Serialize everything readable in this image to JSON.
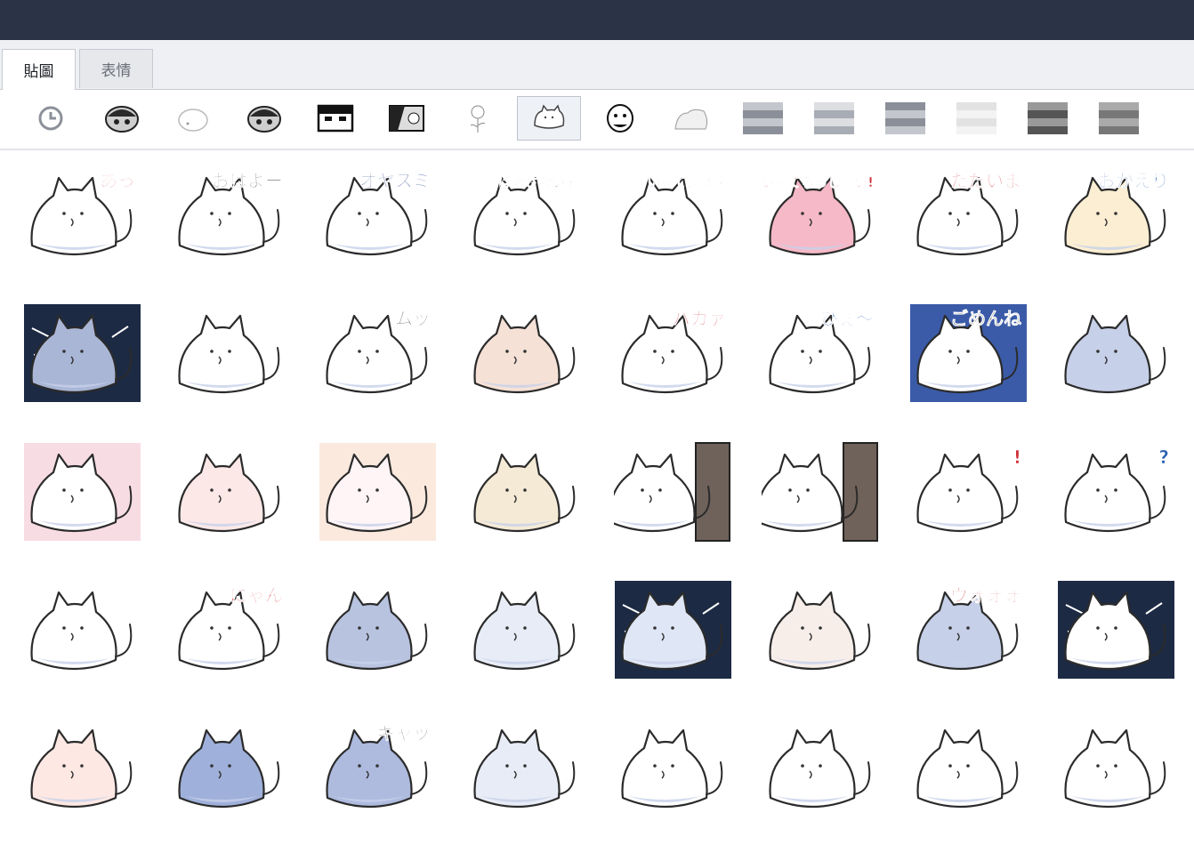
{
  "window": {
    "title": ""
  },
  "tabs": [
    {
      "label": "貼圖",
      "active": true
    },
    {
      "label": "表情",
      "active": false
    }
  ],
  "packs": [
    {
      "icon": "recent-clock-icon",
      "style": "clock"
    },
    {
      "icon": "sticker-pack-icon",
      "style": "dark"
    },
    {
      "icon": "sticker-pack-icon",
      "style": "blob"
    },
    {
      "icon": "sticker-pack-icon",
      "style": "dark"
    },
    {
      "icon": "sticker-pack-icon",
      "style": "face"
    },
    {
      "icon": "sticker-pack-icon",
      "style": "manga"
    },
    {
      "icon": "sticker-pack-icon",
      "style": "flower"
    },
    {
      "icon": "sticker-pack-icon",
      "style": "cat",
      "selected": true
    },
    {
      "icon": "sticker-pack-icon",
      "style": "ghost"
    },
    {
      "icon": "sticker-pack-icon",
      "style": "light"
    },
    {
      "icon": "sticker-pack-icon",
      "style": "pixel"
    },
    {
      "icon": "sticker-pack-icon",
      "style": "pixel"
    },
    {
      "icon": "sticker-pack-icon",
      "style": "pixel"
    },
    {
      "icon": "sticker-pack-icon",
      "style": "pixel-light"
    },
    {
      "icon": "sticker-pack-icon",
      "style": "pixel-dark"
    },
    {
      "icon": "sticker-pack-icon",
      "style": "pixel-dark"
    }
  ],
  "stickers": [
    {
      "text": "あっ",
      "text_color": "#d0303a",
      "bg": "none",
      "tint": "#ffffff"
    },
    {
      "text": "おはよー",
      "text_color": "#222222",
      "bg": "none",
      "tint": "#ffffff"
    },
    {
      "text": "オヤスミ",
      "text_color": "#1f3a8a",
      "bg": "none",
      "tint": "#ffffff"
    },
    {
      "text": "はなさないぞ",
      "text_color": "#222222",
      "bg": "none",
      "tint": "#ffffff"
    },
    {
      "text": "いってきます",
      "text_color": "#2a5fb0",
      "bg": "none",
      "tint": "#ffffff"
    },
    {
      "text": "いってらっしゃい!",
      "text_color": "#d0303a",
      "bg": "none",
      "tint": "#f6b9c8"
    },
    {
      "text": "ただいま",
      "text_color": "#d0303a",
      "bg": "none",
      "tint": "#ffffff"
    },
    {
      "text": "おかえり",
      "text_color": "#2a5fb0",
      "bg": "none",
      "tint": "#fbeed2"
    },
    {
      "text": "",
      "text_color": "#222222",
      "bg": "dark",
      "tint": "#aab6d6"
    },
    {
      "text": "",
      "text_color": "#222222",
      "bg": "none",
      "tint": "#ffffff"
    },
    {
      "text": "ムッ",
      "text_color": "#222222",
      "bg": "none",
      "tint": "#ffffff"
    },
    {
      "text": "",
      "text_color": "#d0303a",
      "bg": "none",
      "tint": "#f5e1d6"
    },
    {
      "text": "バカァ",
      "text_color": "#d0303a",
      "bg": "none",
      "tint": "#ffffff"
    },
    {
      "text": "ひぇ～",
      "text_color": "#2a5fb0",
      "bg": "none",
      "tint": "#ffffff"
    },
    {
      "text": "ごめんね",
      "text_color": "#222222",
      "bg": "blue",
      "tint": "#ffffff"
    },
    {
      "text": "",
      "text_color": "#222222",
      "bg": "none",
      "tint": "#c6d0e8"
    },
    {
      "text": "",
      "text_color": "#d0303a",
      "bg": "pink",
      "tint": "#ffffff"
    },
    {
      "text": "",
      "text_color": "#222222",
      "bg": "none",
      "tint": "#fde8e8"
    },
    {
      "text": "",
      "text_color": "#222222",
      "bg": "peach",
      "tint": "#fff4f6"
    },
    {
      "text": "",
      "text_color": "#222222",
      "bg": "none",
      "tint": "#f5ead6"
    },
    {
      "text": "",
      "text_color": "#222222",
      "bg": "door",
      "tint": "#ffffff"
    },
    {
      "text": "",
      "text_color": "#222222",
      "bg": "door",
      "tint": "#ffffff"
    },
    {
      "text": "!",
      "text_color": "#d0303a",
      "bg": "none",
      "tint": "#ffffff"
    },
    {
      "text": "?",
      "text_color": "#2a5fb0",
      "bg": "none",
      "tint": "#ffffff"
    },
    {
      "text": "",
      "text_color": "#222222",
      "bg": "none",
      "tint": "#ffffff"
    },
    {
      "text": "にゃん",
      "text_color": "#d0303a",
      "bg": "none",
      "tint": "#ffffff"
    },
    {
      "text": "",
      "text_color": "#222222",
      "bg": "none",
      "tint": "#b8c3e0"
    },
    {
      "text": "",
      "text_color": "#222222",
      "bg": "none",
      "tint": "#e7ecf6"
    },
    {
      "text": "",
      "text_color": "#222222",
      "bg": "dark",
      "tint": "#dfe6f5"
    },
    {
      "text": "",
      "text_color": "#222222",
      "bg": "none",
      "tint": "#f7eeea"
    },
    {
      "text": "ウォォォ",
      "text_color": "#d0303a",
      "bg": "none",
      "tint": "#c6d0e8"
    },
    {
      "text": "",
      "text_color": "#222222",
      "bg": "dark",
      "tint": "#ffffff"
    },
    {
      "text": "",
      "text_color": "#222222",
      "bg": "none",
      "tint": "#fde8e4"
    },
    {
      "text": "",
      "text_color": "#222222",
      "bg": "none",
      "tint": "#9fb0da"
    },
    {
      "text": "ギャッ",
      "text_color": "#222222",
      "bg": "none",
      "tint": "#aebbdf"
    },
    {
      "text": "",
      "text_color": "#222222",
      "bg": "none",
      "tint": "#e7ecf6"
    },
    {
      "text": "",
      "text_color": "#d0303a",
      "bg": "none",
      "tint": "#ffffff"
    },
    {
      "text": "",
      "text_color": "#2a8ee0",
      "bg": "none",
      "tint": "#ffffff"
    },
    {
      "text": "",
      "text_color": "#222222",
      "bg": "none",
      "tint": "#ffffff"
    },
    {
      "text": "",
      "text_color": "#222222",
      "bg": "none",
      "tint": "#ffffff"
    }
  ]
}
